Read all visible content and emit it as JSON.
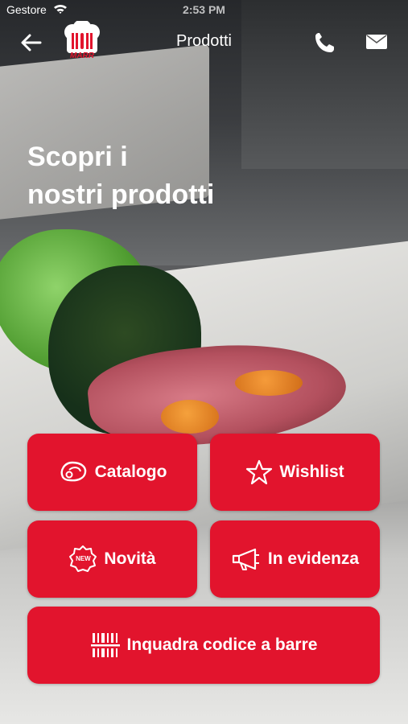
{
  "status_bar": {
    "carrier": "Gestore",
    "time": "2:53 PM"
  },
  "nav": {
    "title": "Prodotti",
    "logo_text": "MARR"
  },
  "hero": {
    "line1": "Scopri i",
    "line2": "nostri prodotti"
  },
  "tiles": [
    {
      "label": "Catalogo",
      "icon": "steak-icon"
    },
    {
      "label": "Wishlist",
      "icon": "star-icon"
    },
    {
      "label": "Novità",
      "icon": "new-badge-icon",
      "icon_text": "NEW"
    },
    {
      "label": "In evidenza",
      "icon": "megaphone-icon"
    },
    {
      "label": "Inquadra codice a barre",
      "icon": "barcode-icon"
    }
  ],
  "colors": {
    "accent": "#e2142d",
    "text": "#ffffff"
  }
}
